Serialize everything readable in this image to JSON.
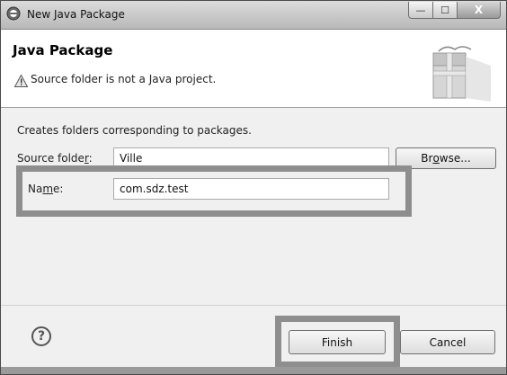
{
  "window": {
    "title": "New Java Package",
    "minimize_glyph": "—",
    "maximize_glyph": "☐",
    "close_glyph": "X"
  },
  "header": {
    "title": "Java Package",
    "message": "Source folder is not a Java project."
  },
  "body": {
    "description": "Creates folders corresponding to packages.",
    "source_folder": {
      "label_pre": "Source folde",
      "label_mnemonic": "r",
      "label_post": ":",
      "value": "Ville"
    },
    "name": {
      "label_pre": "Na",
      "label_mnemonic": "m",
      "label_post": "e:",
      "value": "com.sdz.test"
    },
    "browse": {
      "label_pre": "Br",
      "label_mnemonic": "o",
      "label_post": "wse..."
    }
  },
  "footer": {
    "help_glyph": "?",
    "finish_label": "Finish",
    "cancel_label": "Cancel"
  },
  "icons": {
    "app": "eclipse-icon",
    "warning": "warning-icon",
    "package": "package-wizard-icon",
    "help": "help-icon"
  },
  "colors": {
    "highlight": "#8e8e8e",
    "header_bg": "#ffffff",
    "dialog_bg": "#f0f0f0"
  }
}
